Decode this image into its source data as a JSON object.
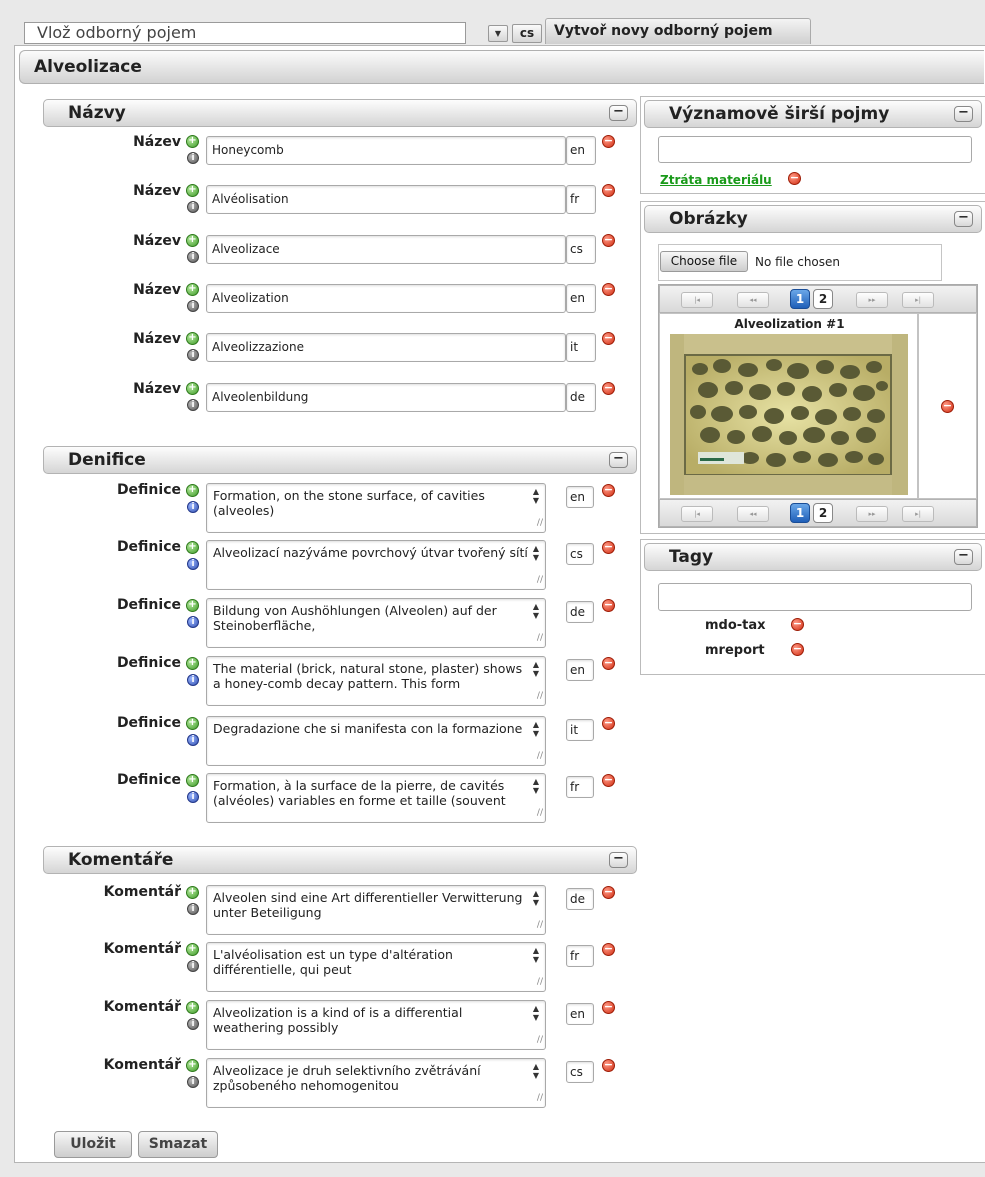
{
  "top": {
    "term_placeholder": "Vlož odborný pojem",
    "lang": "cs",
    "create_tab": "Vytvoř novy odborný pojem"
  },
  "main_title": "Alveolizace",
  "names": {
    "title": "Názvy",
    "rows": [
      {
        "label": "Název",
        "value": "Honeycomb",
        "lang": "en"
      },
      {
        "label": "Název",
        "value": "Alvéolisation",
        "lang": "fr"
      },
      {
        "label": "Název",
        "value": "Alveolizace",
        "lang": "cs"
      },
      {
        "label": "Název",
        "value": "Alveolization",
        "lang": "en"
      },
      {
        "label": "Název",
        "value": "Alveolizzazione",
        "lang": "it"
      },
      {
        "label": "Název",
        "value": "Alveolenbildung",
        "lang": "de"
      }
    ]
  },
  "definitions": {
    "title": "Denifice",
    "rows": [
      {
        "label": "Definice",
        "text": "Formation, on the stone surface, of cavities (alveoles)",
        "lang": "en"
      },
      {
        "label": "Definice",
        "text": "Alveolizací nazýváme povrchový útvar tvořený sítí",
        "lang": "cs"
      },
      {
        "label": "Definice",
        "text": "Bildung von Aushöhlungen (Alveolen) auf der Steinoberfläche,",
        "lang": "de"
      },
      {
        "label": "Definice",
        "text": "The material (brick, natural stone, plaster) shows a honey-comb decay pattern. This form",
        "lang": "en"
      },
      {
        "label": "Definice",
        "text": "Degradazione che si manifesta con la formazione",
        "lang": "it"
      },
      {
        "label": "Definice",
        "text": "Formation, à la surface de la pierre, de cavités (alvéoles) variables en forme et taille (souvent",
        "lang": "fr"
      }
    ]
  },
  "comments": {
    "title": "Komentáře",
    "rows": [
      {
        "label": "Komentář",
        "text": "Alveolen sind eine Art differentieller Verwitterung unter Beteiligung",
        "lang": "de"
      },
      {
        "label": "Komentář",
        "text": "L'alvéolisation est un type d'altération différentielle, qui peut",
        "lang": "fr"
      },
      {
        "label": "Komentář",
        "text": "Alveolization is a kind of is a differential weathering possibly",
        "lang": "en"
      },
      {
        "label": "Komentář",
        "text": "Alveolizace je druh selektivního zvětrávání způsobeného nehomogenitou",
        "lang": "cs"
      }
    ]
  },
  "broader": {
    "title": "Významově širší pojmy",
    "link": "Ztráta materiálu"
  },
  "images": {
    "title": "Obrázky",
    "choose_file": "Choose file",
    "no_file": "No file chosen",
    "pages": [
      "1",
      "2"
    ],
    "caption": "Alveolization #1"
  },
  "tags": {
    "title": "Tagy",
    "items": [
      "mdo-tax",
      "mreport"
    ]
  },
  "buttons": {
    "save": "Uložit",
    "delete": "Smazat"
  },
  "glyphs": {
    "plus": "+",
    "minus": "−",
    "info": "i",
    "collapse": "−",
    "dropdown": "▼",
    "first": "|◂",
    "prev": "◂◂",
    "next": "▸▸",
    "last": "▸|",
    "spin": "▲\n▼",
    "grip": "//"
  }
}
